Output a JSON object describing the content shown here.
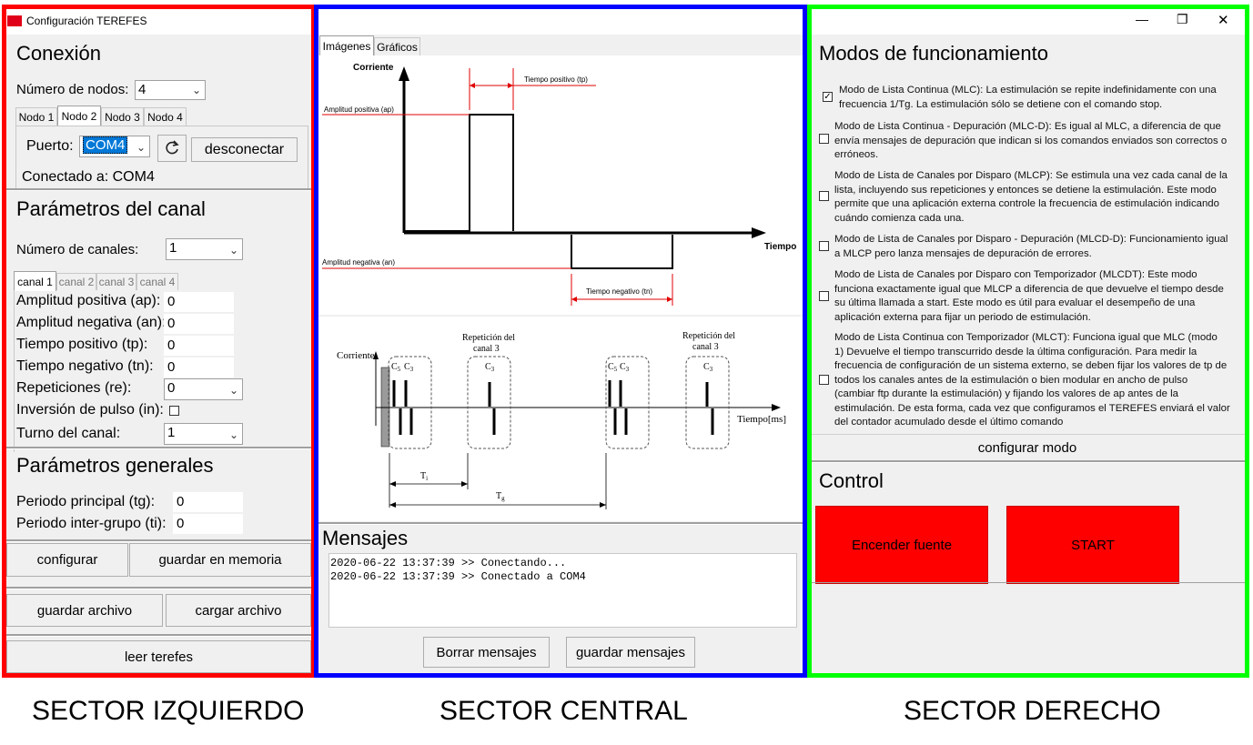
{
  "window": {
    "title": "Configuración TEREFES",
    "controls": [
      "—",
      "❐",
      "✕"
    ]
  },
  "left": {
    "connection": {
      "heading": "Conexión",
      "nodes_label": "Número de nodos:",
      "nodes_value": "4",
      "node_tabs": [
        "Nodo 1",
        "Nodo 2",
        "Nodo 3",
        "Nodo 4"
      ],
      "active_node_tab": 1,
      "port_label": "Puerto:",
      "port_value": "COM4",
      "refresh_icon": "refresh-icon",
      "disconnect_label": "desconectar",
      "status": "Conectado a: COM4"
    },
    "channel": {
      "heading": "Parámetros del canal",
      "channels_label": "Número de canales:",
      "channels_value": "1",
      "channel_tabs": [
        "canal 1",
        "canal 2",
        "canal 3",
        "canal 4"
      ],
      "active_channel_tab": 0,
      "pos_amp_label": "Amplitud positiva (ap):",
      "pos_amp_value": "0",
      "neg_amp_label": "Amplitud negativa (an):",
      "neg_amp_value": "0",
      "pos_time_label": "Tiempo positivo (tp):",
      "pos_time_value": "0",
      "neg_time_label": "Tiempo negativo (tn):",
      "neg_time_value": "0",
      "reps_label": "Repeticiones (re):",
      "reps_value": "0",
      "inversion_label": "Inversión de pulso (in):",
      "inversion_checked": false,
      "turn_label": "Turno del canal:",
      "turn_value": "1"
    },
    "general": {
      "heading": "Parámetros generales",
      "tg_label": "Periodo principal (tg):",
      "tg_value": "0",
      "ti_label": "Periodo inter-grupo (ti):",
      "ti_value": "0"
    },
    "buttons": {
      "configure": "configurar",
      "save_memory": "guardar en memoria",
      "save_file": "guardar archivo",
      "load_file": "cargar archivo",
      "read": "leer terefes"
    }
  },
  "center": {
    "tabs": [
      "Imágenes",
      "Gráficos"
    ],
    "active_tab": 0,
    "diagram1": {
      "y_label": "Corriente",
      "x_label": "Tiempo",
      "tp_label": "Tiempo positivo (tp)",
      "ap_label": "Amplitud positiva (ap)",
      "an_label": "Amplitud negativa (an)",
      "tn_label": "Tiempo negativo (tn)"
    },
    "diagram2": {
      "y_label": "Corriente",
      "x_label": "Tiempo[ms]",
      "rep_label_1": "Repetición del",
      "rep_label_2": "canal 3",
      "c5": "C",
      "c5_sub": "5",
      "c3": "C",
      "c3_sub": "3",
      "ti": "T",
      "ti_sub": "i",
      "tg": "T",
      "tg_sub": "g"
    },
    "messages": {
      "heading": "Mensajes",
      "lines": [
        "2020-06-22 13:37:39 >> Conectando...",
        "2020-06-22 13:37:39 >> Conectado a COM4"
      ],
      "clear_label": "Borrar mensajes",
      "save_label": "guardar mensajes"
    }
  },
  "right": {
    "modes_heading": "Modos de funcionamiento",
    "modes": [
      {
        "checked": true,
        "lines": [
          "Modo de Lista Continua (MLC): La estimulación se repite indefinidamente con una",
          "frecuencia 1/Tg. La estimulación sólo se detiene con el comando stop."
        ]
      },
      {
        "checked": false,
        "lines": [
          "Modo de Lista Continua - Depuración (MLC-D): Es igual al MLC, a diferencia de que",
          "envía mensajes de depuración que indican si los comandos enviados son correctos o",
          "erróneos."
        ]
      },
      {
        "checked": false,
        "lines": [
          "Modo de Lista de Canales por Disparo (MLCP): Se estimula una vez cada canal de la",
          "lista, incluyendo sus repeticiones y entonces se detiene la estimulación. Este modo",
          "permite que una aplicación externa controle la frecuencia de estimulación indicando",
          "cuándo comienza cada una."
        ]
      },
      {
        "checked": false,
        "lines": [
          "Modo de Lista de Canales por Disparo - Depuración (MLCD-D): Funcionamiento igual",
          "a MLCP pero lanza mensajes de depuración de errores."
        ]
      },
      {
        "checked": false,
        "lines": [
          "Modo de Lista de Canales por Disparo con Temporizador (MLCDT): Este modo",
          "funciona exactamente igual que MLCP a diferencia de que devuelve el tiempo desde",
          "su última llamada a start. Este modo es útil para evaluar el desempeño de una",
          "aplicación externa para fijar un periodo de estimulación."
        ]
      },
      {
        "checked": false,
        "lines": [
          "Modo de Lista Continua con Temporizador (MLCT): Funciona igual que MLC (modo",
          "1) Devuelve el tiempo transcurrido desde la última configuración. Para medir la",
          "frecuencia de configuración de un sistema externo, se deben fijar los valores de tp de",
          "todos los canales antes de la estimulación o bien modular en ancho de pulso",
          "(cambiar ftp durante la estimulación) y fijando los valores de ap antes de la",
          "estimulación. De esta forma, cada vez que configuramos el TEREFES enviará el valor",
          "del contador acumulado desde el último comando"
        ]
      }
    ],
    "configure_mode": "configurar modo",
    "control_heading": "Control",
    "power_label": "Encender fuente",
    "start_label": "START",
    "red": "#ff0000"
  },
  "sectors": {
    "left": {
      "label": "SECTOR IZQUIERDO",
      "color": "#ff0000"
    },
    "center": {
      "label": "SECTOR CENTRAL",
      "color": "#0000ff"
    },
    "right": {
      "label": "SECTOR DERECHO",
      "color": "#00ff00"
    }
  }
}
